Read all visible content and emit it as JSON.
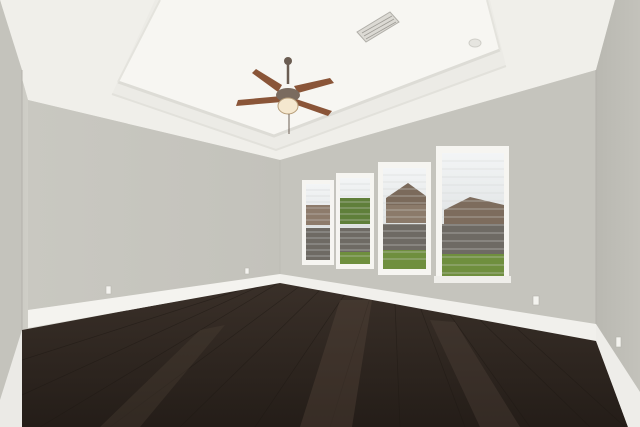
{
  "scene": {
    "description_colors": {
      "ceiling": "#f2f1ec",
      "tray": "#f7f6f2",
      "wall_left": "#cbcac3",
      "wall_back": "#c6c5be",
      "wall_right": "#bdbcb5",
      "trim": "#f4f3ef",
      "floor": "#2e2620",
      "floor_light": "#4a3d34",
      "window_glass": "#e9ecee",
      "grass": "#6f8f3e",
      "fence": "#6e6a64",
      "roof": "#7a6a5c",
      "fan_blade": "#8a5538",
      "fan_body": "#6b5d52"
    },
    "elements": {
      "ceiling_fan": "ceiling-fan",
      "air_vent": "air-vent",
      "windows": [
        "window-1",
        "window-2",
        "window-3",
        "window-4"
      ],
      "outlets": 4
    }
  }
}
